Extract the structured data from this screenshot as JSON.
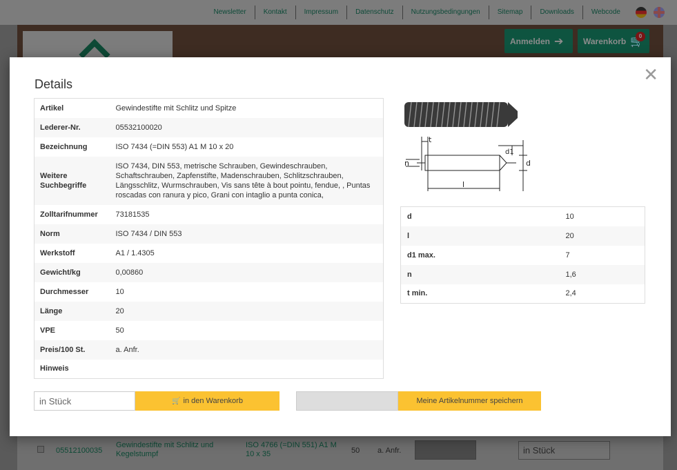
{
  "topnav": {
    "links": [
      "Newsletter",
      "Kontakt",
      "Impressum",
      "Datenschutz",
      "Nutzungsbedingungen",
      "Sitemap",
      "Downloads",
      "Webcode"
    ]
  },
  "header": {
    "login_label": "Anmelden",
    "cart_label": "Warenkorb",
    "cart_count": "0"
  },
  "background_row": {
    "article_no": "05512100035",
    "name": "Gewindestifte mit Schlitz und Kegelstumpf",
    "designation": "ISO 4766 (=DIN 551) A1 M 10 x 35",
    "vpe": "50",
    "price": "a. Anfr.",
    "qty_placeholder": "in Stück"
  },
  "modal": {
    "title": "Details",
    "close_symbol": "✕",
    "details": [
      {
        "key": "Artikel",
        "value": "Gewindestifte mit Schlitz und Spitze"
      },
      {
        "key": "Lederer-Nr.",
        "value": "05532100020"
      },
      {
        "key": "Bezeichnung",
        "value": "ISO 7434 (=DIN 553) A1 M 10 x 20"
      },
      {
        "key": "Weitere Suchbegriffe",
        "value": "ISO 7434, DIN 553, metrische Schrauben, Gewindeschrauben, Schaftschrauben, Zapfenstifte, Madenschrauben, Schlitzschrauben, Längsschlitz, Wurmschrauben, Vis sans tête à bout pointu, fendue, , Puntas roscadas con ranura y pico, Grani con intaglio a punta conica,"
      },
      {
        "key": "Zolltarifnummer",
        "value": "73181535"
      },
      {
        "key": "Norm",
        "value": "ISO 7434 / DIN 553"
      },
      {
        "key": "Werkstoff",
        "value": "A1 / 1.4305"
      },
      {
        "key": "Gewicht/kg",
        "value": "0,00860"
      },
      {
        "key": "Durchmesser",
        "value": "10"
      },
      {
        "key": "Länge",
        "value": "20"
      },
      {
        "key": "VPE",
        "value": "50"
      },
      {
        "key": "Preis/100 St.",
        "value": "a. Anfr."
      },
      {
        "key": "Hinweis",
        "value": ""
      }
    ],
    "drawing_labels": {
      "t": "t",
      "n": "n",
      "d1": "d1",
      "d": "d",
      "l": "l"
    },
    "dimensions": [
      {
        "key": "d",
        "value": "10"
      },
      {
        "key": "l",
        "value": "20"
      },
      {
        "key": "d1 max.",
        "value": "7"
      },
      {
        "key": "n",
        "value": "1,6"
      },
      {
        "key": "t min.",
        "value": "2,4"
      }
    ],
    "qty_placeholder": "in Stück",
    "cart_button_label": "in den Warenkorb",
    "save_button_label": "Meine Artikelnummer speichern"
  }
}
